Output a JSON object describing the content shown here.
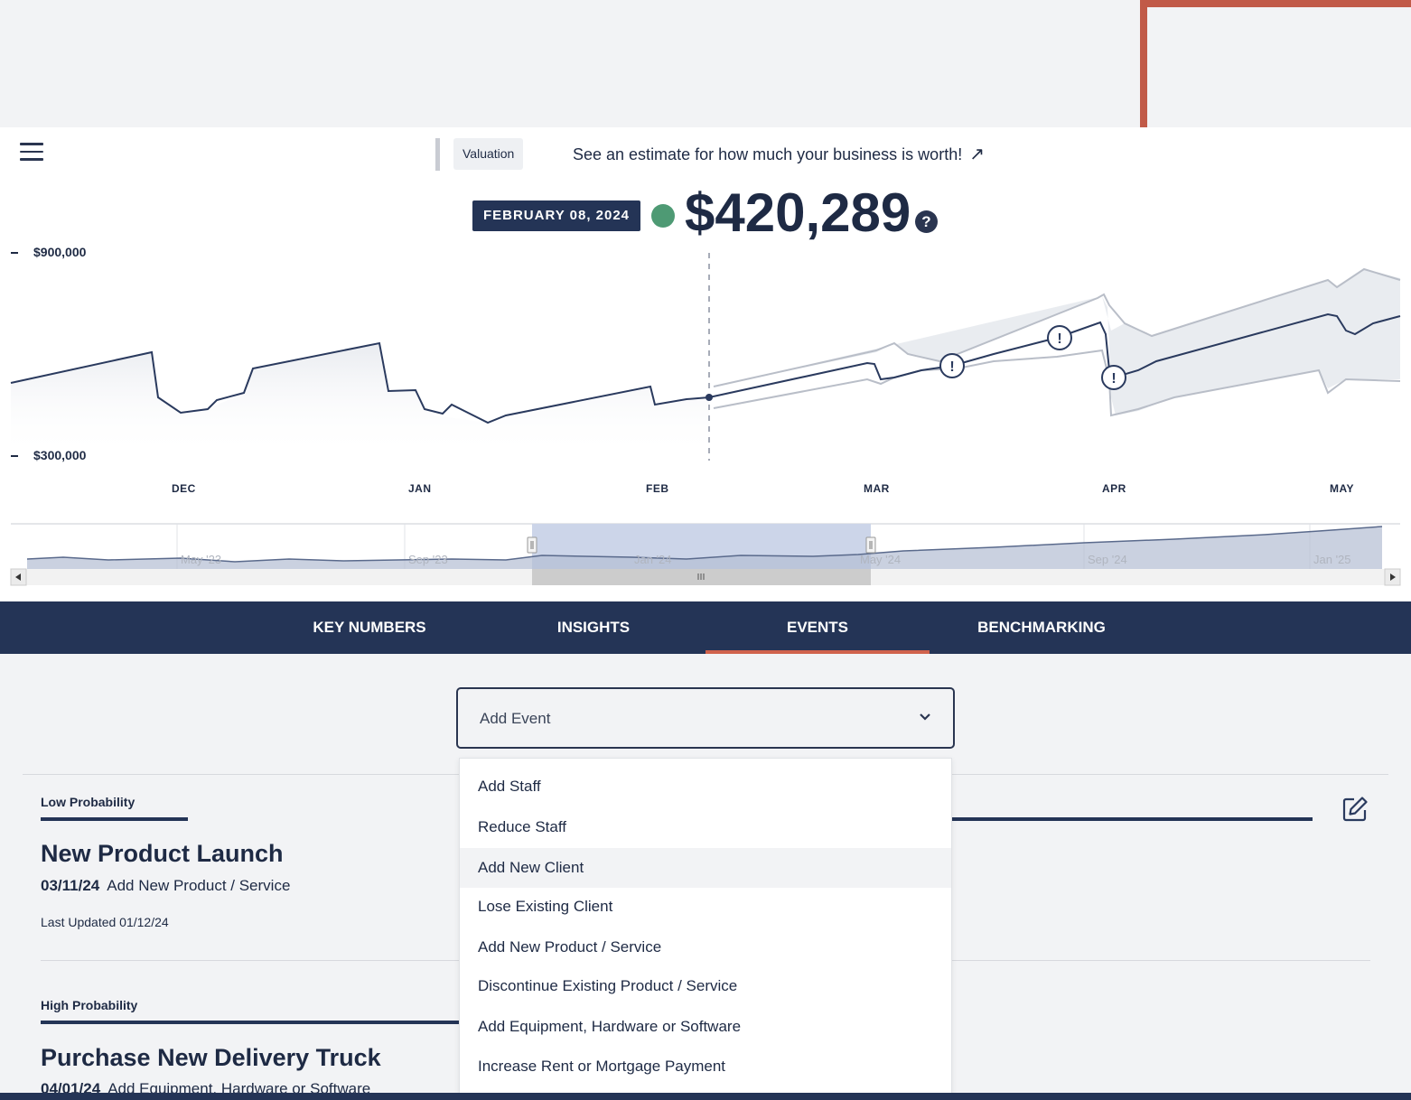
{
  "header": {
    "valuation_tag": "Valuation",
    "estimate_link": "See an estimate for how much your business is worth!",
    "estimate_arrow": "↗"
  },
  "summary": {
    "date": "FEBRUARY 08, 2024",
    "value": "$420,289",
    "help": "?",
    "status_color": "#4e9a74"
  },
  "chart": {
    "y_ticks": [
      "$900,000",
      "$300,000"
    ],
    "x_ticks": [
      "DEC",
      "JAN",
      "FEB",
      "MAR",
      "APR",
      "MAY"
    ],
    "navigator_labels": [
      "May '23",
      "Sep '23",
      "Jan '24",
      "May '24",
      "Sep '24",
      "Jan '25"
    ],
    "event_marker": "!",
    "colors": {
      "line": "#2a3a5e",
      "band": "#b9bec8",
      "accent": "#d0624c"
    }
  },
  "tabs": [
    {
      "label": "KEY NUMBERS"
    },
    {
      "label": "INSIGHTS"
    },
    {
      "label": "EVENTS"
    },
    {
      "label": "BENCHMARKING"
    }
  ],
  "add_event": {
    "placeholder": "Add Event"
  },
  "dropdown": {
    "items": [
      "Add Staff",
      "Reduce Staff",
      "Add New Client",
      "Lose Existing Client",
      "Add New Product / Service",
      "Discontinue Existing Product / Service",
      "Add Equipment, Hardware or Software",
      "Increase Rent or Mortgage Payment"
    ]
  },
  "events": [
    {
      "probability": "Low Probability",
      "title": "New Product Launch",
      "date": "03/11/24",
      "type": "Add New Product / Service",
      "updated": "Last Updated 01/12/24"
    },
    {
      "probability": "High Probability",
      "title": "Purchase New Delivery Truck",
      "date": "04/01/24",
      "type": "Add Equipment, Hardware or Software"
    }
  ]
}
